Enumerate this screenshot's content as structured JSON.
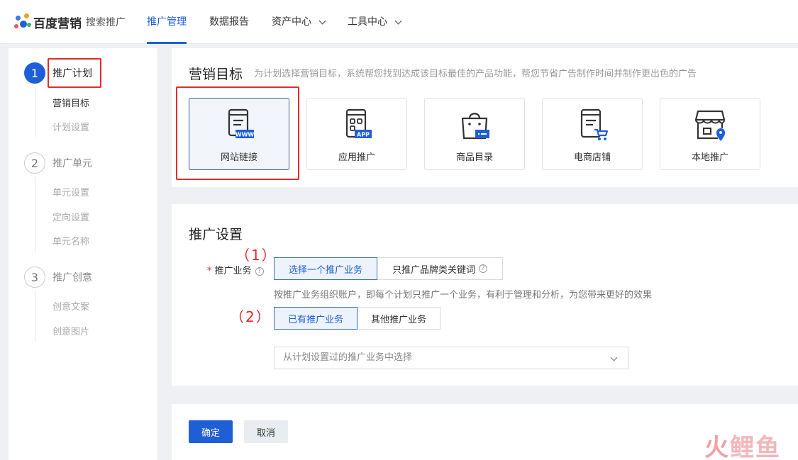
{
  "header": {
    "logo_text": "百度营销",
    "logo_sub": "搜索推广",
    "nav": [
      {
        "label": "推广管理",
        "active": true
      },
      {
        "label": "数据报告"
      },
      {
        "label": "资产中心",
        "dropdown": true
      },
      {
        "label": "工具中心",
        "dropdown": true
      }
    ]
  },
  "sidebar": {
    "steps": [
      {
        "num": "1",
        "label": "推广计划",
        "active": true,
        "subs": [
          "营销目标",
          "计划设置"
        ]
      },
      {
        "num": "2",
        "label": "推广单元",
        "subs": [
          "单元设置",
          "定向设置",
          "单元名称"
        ]
      },
      {
        "num": "3",
        "label": "推广创意",
        "subs": [
          "创意文案",
          "创意图片"
        ]
      }
    ]
  },
  "goal": {
    "title": "营销目标",
    "desc": "为计划选择营销目标，系统帮您找到达成该目标最佳的产品功能，帮您节省广告制作时间并制作更出色的广告",
    "cards": [
      {
        "label": "网站链接",
        "icon": "website-icon",
        "badge": "WWW",
        "selected": true
      },
      {
        "label": "应用推广",
        "icon": "app-icon",
        "badge": "APP"
      },
      {
        "label": "商品目录",
        "icon": "catalog-bag-icon"
      },
      {
        "label": "电商店铺",
        "icon": "shop-cart-icon"
      },
      {
        "label": "本地推广",
        "icon": "local-store-icon"
      }
    ]
  },
  "settings": {
    "title": "推广设置",
    "anno1": "（1）",
    "anno2": "（2）",
    "business_label": "推广业务",
    "seg1": [
      "选择一个推广业务",
      "只推广品牌类关键词"
    ],
    "hint": "按推广业务组织账户，即每个计划只推广一个业务，有利于管理和分析，为您带来更好的效果",
    "seg2": [
      "已有推广业务",
      "其他推广业务"
    ],
    "select_placeholder": "从计划设置过的推广业务中选择"
  },
  "actions": {
    "ok": "确定",
    "cancel": "取消"
  },
  "watermark": {
    "part1": "火",
    "part2": "鲤鱼"
  },
  "colors": {
    "primary": "#1f5fd6",
    "annotation_red": "#e02c2c"
  }
}
